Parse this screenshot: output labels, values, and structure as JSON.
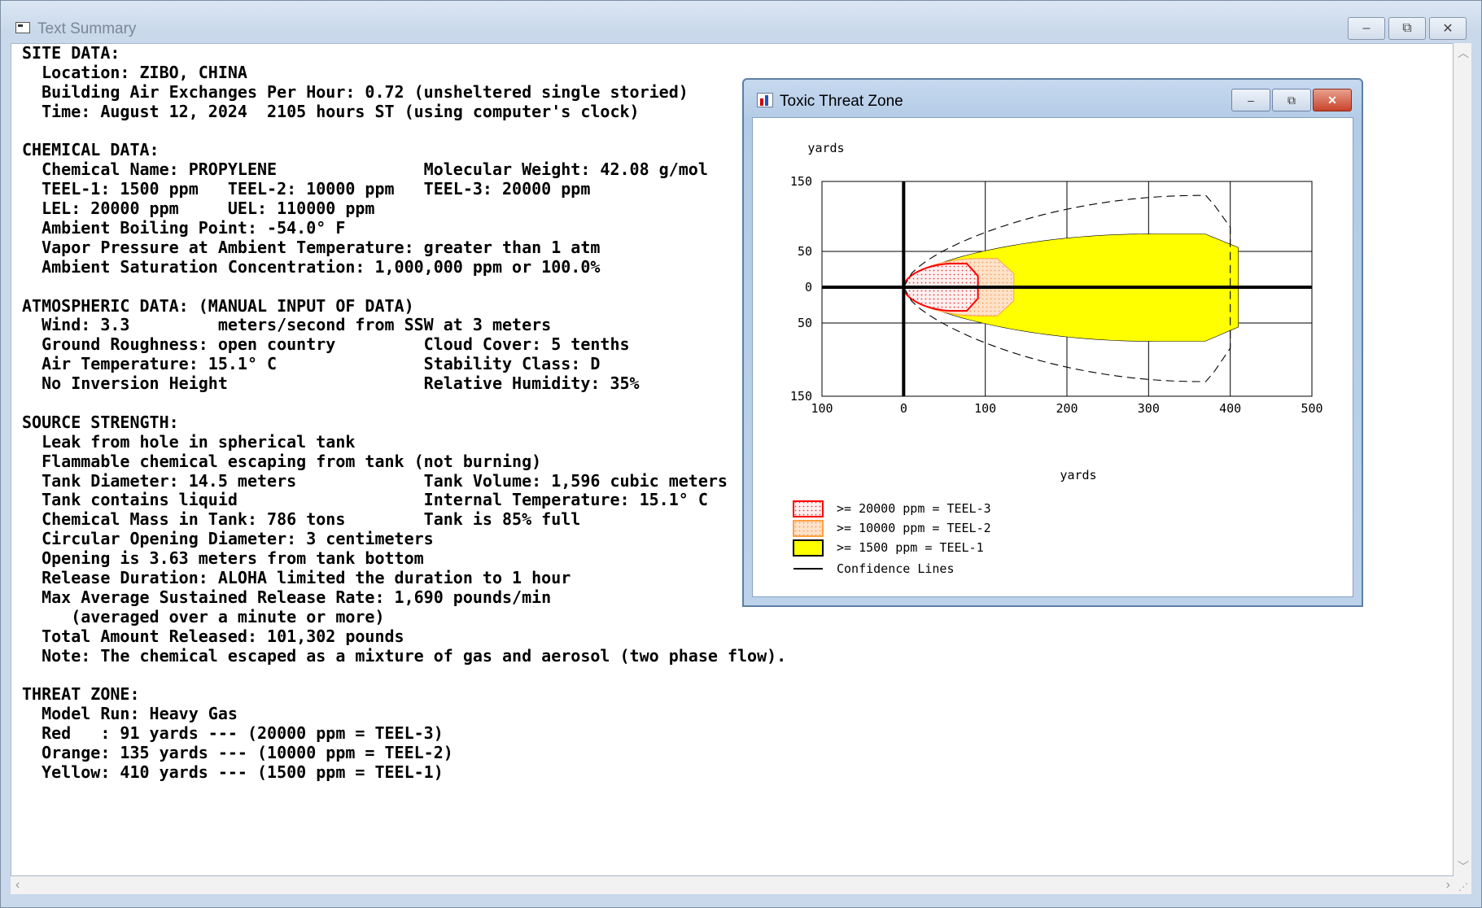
{
  "window": {
    "title": "Text Summary",
    "minimize_glyph": "–",
    "maximize_glyph": "⧉",
    "close_glyph": "✕"
  },
  "report_lines": [
    "SITE DATA:",
    "  Location: ZIBO, CHINA",
    "  Building Air Exchanges Per Hour: 0.72 (unsheltered single storied)",
    "  Time: August 12, 2024  2105 hours ST (using computer's clock)",
    "",
    "CHEMICAL DATA:",
    "  Chemical Name: PROPYLENE               Molecular Weight: 42.08 g/mol",
    "  TEEL-1: 1500 ppm   TEEL-2: 10000 ppm   TEEL-3: 20000 ppm",
    "  LEL: 20000 ppm     UEL: 110000 ppm",
    "  Ambient Boiling Point: -54.0° F",
    "  Vapor Pressure at Ambient Temperature: greater than 1 atm",
    "  Ambient Saturation Concentration: 1,000,000 ppm or 100.0%",
    "",
    "ATMOSPHERIC DATA: (MANUAL INPUT OF DATA)",
    "  Wind: 3.3         meters/second from SSW at 3 meters",
    "  Ground Roughness: open country         Cloud Cover: 5 tenths",
    "  Air Temperature: 15.1° C               Stability Class: D",
    "  No Inversion Height                    Relative Humidity: 35%",
    "",
    "SOURCE STRENGTH:",
    "  Leak from hole in spherical tank",
    "  Flammable chemical escaping from tank (not burning)",
    "  Tank Diameter: 14.5 meters             Tank Volume: 1,596 cubic meters",
    "  Tank contains liquid                   Internal Temperature: 15.1° C",
    "  Chemical Mass in Tank: 786 tons        Tank is 85% full",
    "  Circular Opening Diameter: 3 centimeters",
    "  Opening is 3.63 meters from tank bottom",
    "  Release Duration: ALOHA limited the duration to 1 hour",
    "  Max Average Sustained Release Rate: 1,690 pounds/min",
    "     (averaged over a minute or more)",
    "  Total Amount Released: 101,302 pounds",
    "  Note: The chemical escaped as a mixture of gas and aerosol (two phase flow).",
    "",
    "THREAT ZONE:",
    "  Model Run: Heavy Gas",
    "  Red   : 91 yards --- (20000 ppm = TEEL-3)",
    "  Orange: 135 yards --- (10000 ppm = TEEL-2)",
    "  Yellow: 410 yards --- (1500 ppm = TEEL-1)"
  ],
  "chart_window": {
    "title": "Toxic Threat Zone"
  },
  "chart_data": {
    "type": "area",
    "ylabel": "yards",
    "xlabel": "yards",
    "x_ticks": [
      "100",
      "0",
      "100",
      "200",
      "300",
      "400",
      "500"
    ],
    "y_ticks": [
      "150",
      "50",
      "0",
      "50",
      "150"
    ],
    "xlim": [
      -100,
      500
    ],
    "ylim": [
      -150,
      150
    ],
    "grid": true,
    "zones": [
      {
        "name": ">= 20000 ppm = TEEL-3",
        "color": "#ff0000",
        "fill": "#ffd6d6",
        "pattern": "dotted",
        "downwind_yards": 91,
        "max_halfwidth_yards": 33
      },
      {
        "name": ">= 10000 ppm = TEEL-2",
        "color": "#ffa040",
        "fill": "#ffd9b8",
        "pattern": "dotted",
        "downwind_yards": 135,
        "max_halfwidth_yards": 40
      },
      {
        "name": ">= 1500 ppm = TEEL-1",
        "color": "#000000",
        "fill": "#ffff00",
        "pattern": "solid",
        "downwind_yards": 410,
        "max_halfwidth_yards": 75
      }
    ],
    "confidence_lines": {
      "name": "Confidence Lines",
      "downwind_yards": 400,
      "max_halfwidth_yards": 130
    },
    "legend_position": "bottom-left"
  }
}
